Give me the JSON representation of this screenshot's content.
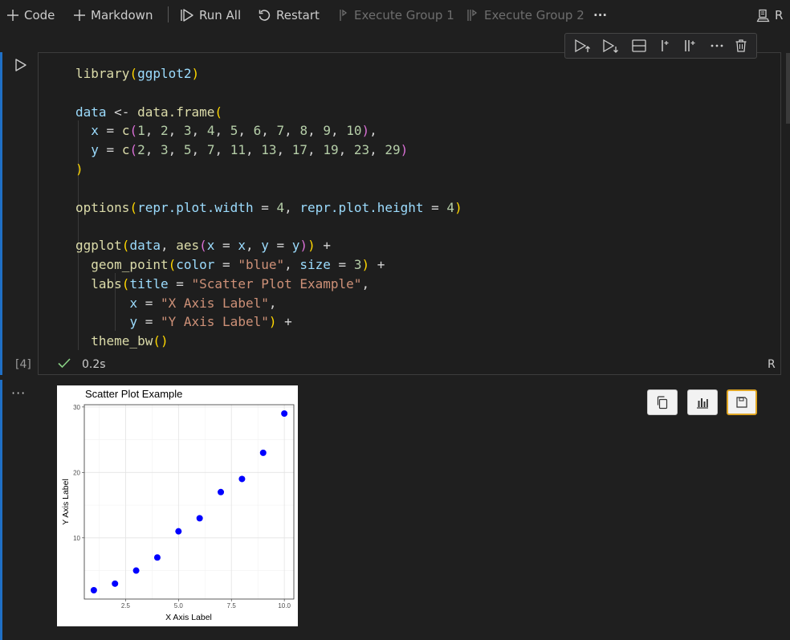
{
  "toolbar": {
    "code_label": "Code",
    "markdown_label": "Markdown",
    "run_all_label": "Run All",
    "restart_label": "Restart",
    "execute_group_1_label": "Execute Group 1",
    "execute_group_2_label": "Execute Group 2",
    "more_label": "···",
    "kernel_label": "R"
  },
  "cell": {
    "execution_count": "[4]",
    "duration": "0.2s",
    "language": "R",
    "code_lines": [
      "library(ggplot2)",
      "",
      "data <- data.frame(",
      "  x = c(1, 2, 3, 4, 5, 6, 7, 8, 9, 10),",
      "  y = c(2, 3, 5, 7, 11, 13, 17, 19, 23, 29)",
      ")",
      "",
      "options(repr.plot.width = 4, repr.plot.height = 4)",
      "",
      "ggplot(data, aes(x = x, y = y)) +",
      "  geom_point(color = \"blue\", size = 3) +",
      "  labs(title = \"Scatter Plot Example\",",
      "       x = \"X Axis Label\",",
      "       y = \"Y Axis Label\") +",
      "  theme_bw()"
    ]
  },
  "output": {
    "more_label": "···"
  },
  "chart_data": {
    "type": "scatter",
    "title": "Scatter Plot Example",
    "xlabel": "X Axis Label",
    "ylabel": "Y Axis Label",
    "x": [
      1,
      2,
      3,
      4,
      5,
      6,
      7,
      8,
      9,
      10
    ],
    "y": [
      2,
      3,
      5,
      7,
      11,
      13,
      17,
      19,
      23,
      29
    ],
    "xticks": [
      "2.5",
      "5.0",
      "7.5",
      "10.0"
    ],
    "yticks": [
      "10",
      "20",
      "30"
    ],
    "xlim": [
      0.55,
      10.45
    ],
    "ylim": [
      0.65,
      30.35
    ],
    "point_color": "#0000ff",
    "grid": true
  }
}
